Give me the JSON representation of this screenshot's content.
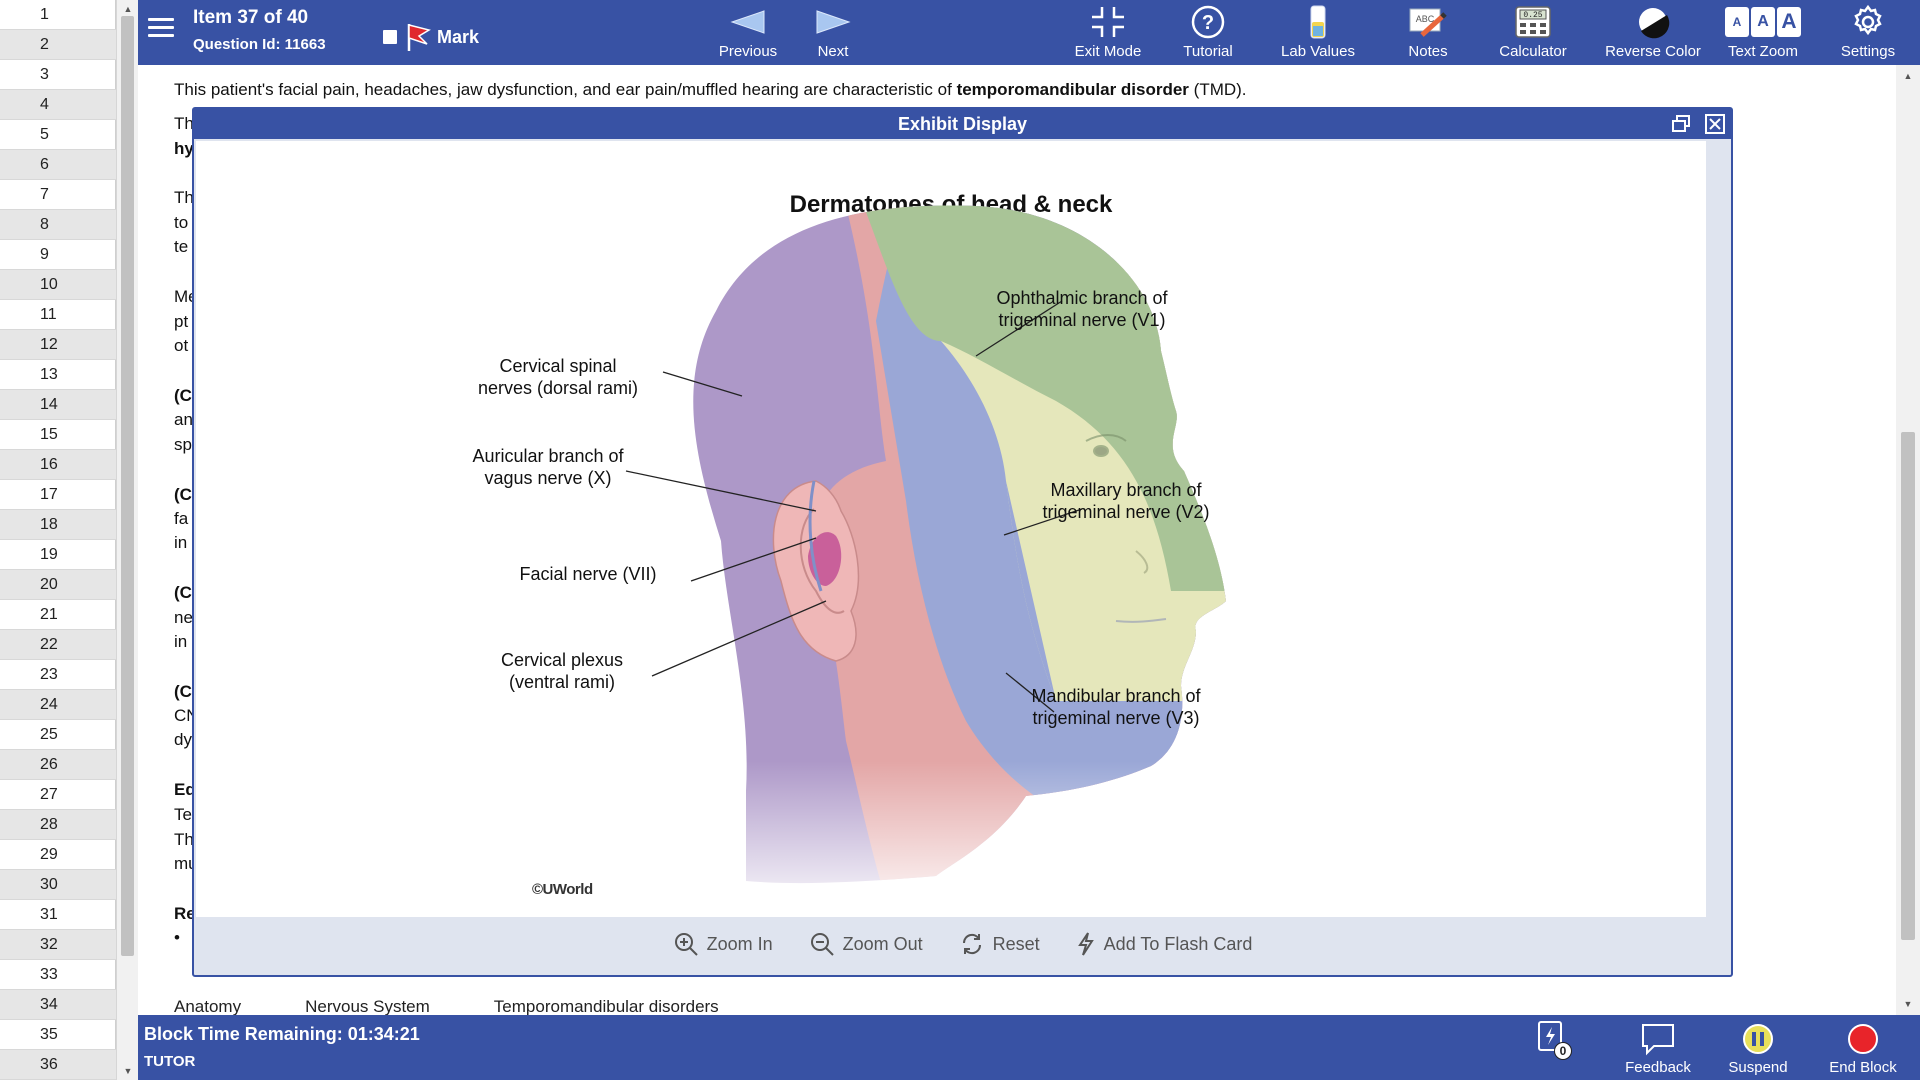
{
  "item_numbers": [
    "1",
    "2",
    "3",
    "4",
    "5",
    "6",
    "7",
    "8",
    "9",
    "10",
    "11",
    "12",
    "13",
    "14",
    "15",
    "16",
    "17",
    "18",
    "19",
    "20",
    "21",
    "22",
    "23",
    "24",
    "25",
    "26",
    "27",
    "28",
    "29",
    "30",
    "31",
    "32",
    "33",
    "34",
    "35",
    "36"
  ],
  "header": {
    "item_title": "Item 37 of 40",
    "question_id": "Question Id: 11663",
    "mark_label": "Mark",
    "previous_label": "Previous",
    "next_label": "Next",
    "tools": {
      "exit_mode": "Exit Mode",
      "tutorial": "Tutorial",
      "lab_values": "Lab Values",
      "notes": "Notes",
      "calculator": "Calculator",
      "reverse_color": "Reverse Color",
      "text_zoom": "Text Zoom",
      "settings": "Settings"
    },
    "calc_display": "0.25",
    "notes_icon_text": "ABC",
    "zoom_letters": [
      "A",
      "A",
      "A"
    ]
  },
  "content": {
    "first_line_pre": "This patient's facial pain, headaches, jaw dysfunction, and ear pain/muffled hearing are characteristic of ",
    "first_line_bold": "temporomandibular disorder",
    "first_line_post": " (TMD).",
    "fragments": [
      "Th",
      "hy",
      "Th",
      "to",
      "te",
      "Me",
      "pt",
      "ot",
      "(C",
      "an",
      "sp",
      "(C",
      "fa",
      "in",
      "(C",
      "ne",
      "in",
      "(C",
      "CN",
      "dy",
      "Ed",
      "Te",
      "Th",
      "mu",
      "Re",
      "•"
    ],
    "tags": [
      "Anatomy",
      "Nervous System",
      "Temporomandibular disorders"
    ]
  },
  "exhibit": {
    "header_title": "Exhibit Display",
    "figure_title": "Dermatomes of head & neck",
    "labels": {
      "v1": [
        "Ophthalmic branch of",
        "trigeminal nerve (V1)"
      ],
      "cervical_spinal": [
        "Cervical spinal",
        "nerves (dorsal rami)"
      ],
      "auricular": [
        "Auricular branch of",
        "vagus nerve (X)"
      ],
      "v2": [
        "Maxillary branch of",
        "trigeminal nerve (V2)"
      ],
      "facial": [
        "Facial nerve (VII)"
      ],
      "cervical_plexus": [
        "Cervical plexus",
        "(ventral rami)"
      ],
      "v3": [
        "Mandibular branch of",
        "trigeminal nerve (V3)"
      ]
    },
    "credit": "©UWorld",
    "controls": {
      "zoom_in": "Zoom In",
      "zoom_out": "Zoom Out",
      "reset": "Reset",
      "flash_card": "Add To Flash Card"
    },
    "colors": {
      "purple": "#ad98c8",
      "green": "#a9c497",
      "blue": "#9aa7d6",
      "yellow": "#e5e7bb",
      "pink": "#e3a6a6",
      "ear_spot": "#c9609a"
    }
  },
  "footer": {
    "block_time": "Block Time Remaining: 01:34:21",
    "mode": "TUTOR",
    "flash_count": "0",
    "feedback": "Feedback",
    "suspend": "Suspend",
    "end_block": "End Block"
  }
}
